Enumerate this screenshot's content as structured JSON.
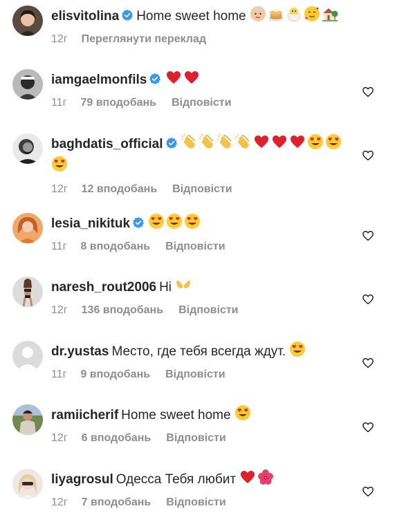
{
  "colors": {
    "text": "#262626",
    "meta": "#8e8e8e",
    "verified": "#3897f0",
    "heart": "#ed2939"
  },
  "comments": [
    {
      "username": "elisvitolina",
      "verified": true,
      "text": "Home sweet home",
      "emoji": [
        "older-woman-emoji",
        "pancakes-emoji",
        "hatching-chick-emoji",
        "smiling-hearts-emoji",
        "house-garden-emoji"
      ],
      "time": "12г",
      "likes": "",
      "action": "Переглянути переклад",
      "avatar": "avatar-woman-dark-hair"
    },
    {
      "username": "iamgaelmonfils",
      "verified": true,
      "text": "",
      "emoji": [
        "red-heart-emoji",
        "red-heart-emoji"
      ],
      "time": "11г",
      "likes": "79 вподобань",
      "action": "Відповісти",
      "avatar": "avatar-man-bw"
    },
    {
      "username": "baghdatis_official",
      "verified": true,
      "text": "",
      "emoji": [
        "clapping-emoji",
        "clapping-emoji",
        "clapping-emoji",
        "clapping-emoji",
        "red-heart-emoji",
        "red-heart-emoji",
        "red-heart-emoji",
        "heart-eyes-emoji",
        "heart-eyes-emoji",
        "heart-eyes-emoji"
      ],
      "time": "12г",
      "likes": "12 вподобань",
      "action": "Відповісти",
      "avatar": "avatar-man-beard"
    },
    {
      "username": "lesia_nikituk",
      "verified": true,
      "text": "",
      "emoji": [
        "heart-eyes-emoji",
        "heart-eyes-emoji",
        "heart-eyes-emoji"
      ],
      "time": "11г",
      "likes": "8 вподобань",
      "action": "Відповісти",
      "avatar": "avatar-woman-red-hair"
    },
    {
      "username": "naresh_rout2006",
      "verified": false,
      "text": "Hi",
      "emoji": [
        "open-hands-emoji"
      ],
      "time": "12г",
      "likes": "136 вподобань",
      "action": "Відповісти",
      "avatar": "avatar-woman-swimsuit"
    },
    {
      "username": "dr.yustas",
      "verified": false,
      "text": "Место, где тебя всегда ждут.",
      "emoji": [
        "heart-eyes-emoji"
      ],
      "time": "11г",
      "likes": "9 вподобань",
      "action": "Відповісти",
      "avatar": "avatar-default"
    },
    {
      "username": "ramiicherif",
      "verified": false,
      "text": "Home sweet home",
      "emoji": [
        "heart-eyes-emoji"
      ],
      "time": "12г",
      "likes": "6 вподобань",
      "action": "Відповісти",
      "avatar": "avatar-man-outdoor"
    },
    {
      "username": "liyagrosul",
      "verified": false,
      "text": "Одесса Тебя любит",
      "emoji": [
        "red-heart-emoji",
        "hibiscus-emoji"
      ],
      "time": "12г",
      "likes": "7 вподобань",
      "action": "Відповісти",
      "avatar": "avatar-woman-blonde"
    }
  ]
}
